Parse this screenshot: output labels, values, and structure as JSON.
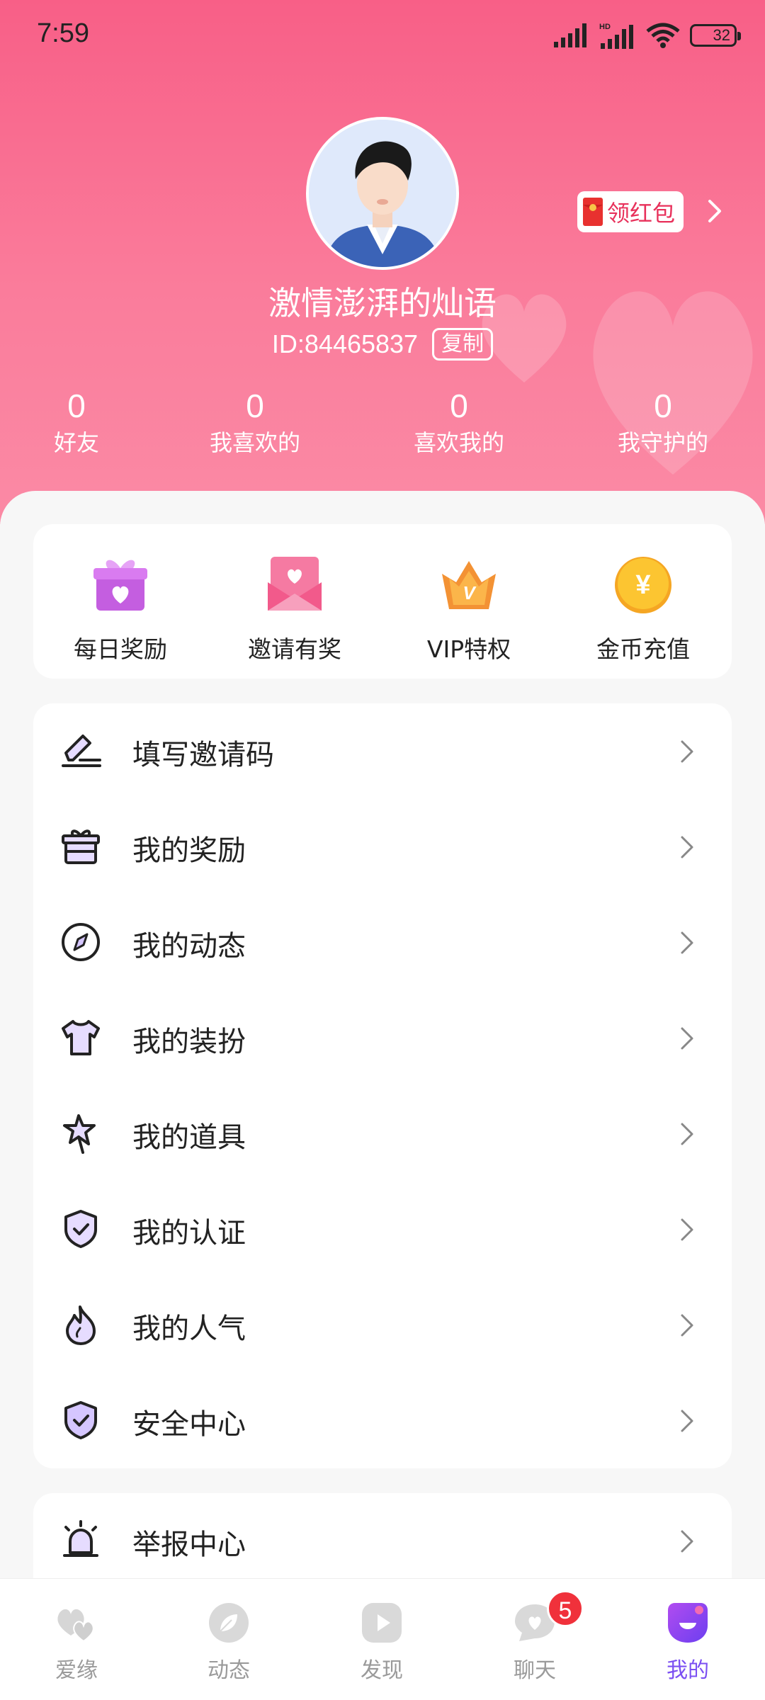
{
  "status_bar": {
    "time": "7:59",
    "battery": "32"
  },
  "profile": {
    "nickname": "激情澎湃的灿语",
    "id_text": "ID:84465837",
    "copy_label": "复制",
    "red_packet_label": "领红包"
  },
  "stats": [
    {
      "value": "0",
      "label": "好友"
    },
    {
      "value": "0",
      "label": "我喜欢的"
    },
    {
      "value": "0",
      "label": "喜欢我的"
    },
    {
      "value": "0",
      "label": "我守护的"
    }
  ],
  "quick_actions": [
    {
      "label": "每日奖励",
      "icon": "gift-icon"
    },
    {
      "label": "邀请有奖",
      "icon": "invite-envelope-icon"
    },
    {
      "label": "VIP特权",
      "icon": "vip-crown-icon"
    },
    {
      "label": "金币充值",
      "icon": "coin-icon"
    }
  ],
  "menu": [
    {
      "label": "填写邀请码",
      "icon": "edit-pen-icon"
    },
    {
      "label": "我的奖励",
      "icon": "gift-box-icon"
    },
    {
      "label": "我的动态",
      "icon": "compass-icon"
    },
    {
      "label": "我的装扮",
      "icon": "shirt-icon"
    },
    {
      "label": "我的道具",
      "icon": "magic-wand-icon"
    },
    {
      "label": "我的认证",
      "icon": "shield-check-icon"
    },
    {
      "label": "我的人气",
      "icon": "flame-icon"
    },
    {
      "label": "安全中心",
      "icon": "security-shield-icon"
    }
  ],
  "report": {
    "label": "举报中心",
    "icon": "alarm-icon"
  },
  "bottom_nav": [
    {
      "label": "爱缘",
      "icon": "hearts-icon",
      "active": false
    },
    {
      "label": "动态",
      "icon": "leaf-icon",
      "active": false
    },
    {
      "label": "发现",
      "icon": "play-icon",
      "active": false
    },
    {
      "label": "聊天",
      "icon": "chat-heart-icon",
      "active": false,
      "badge": "5"
    },
    {
      "label": "我的",
      "icon": "profile-icon",
      "active": true
    }
  ],
  "colors": {
    "header_top": "#f85f87",
    "accent": "#7b4ff2",
    "badge": "#f0313b"
  }
}
